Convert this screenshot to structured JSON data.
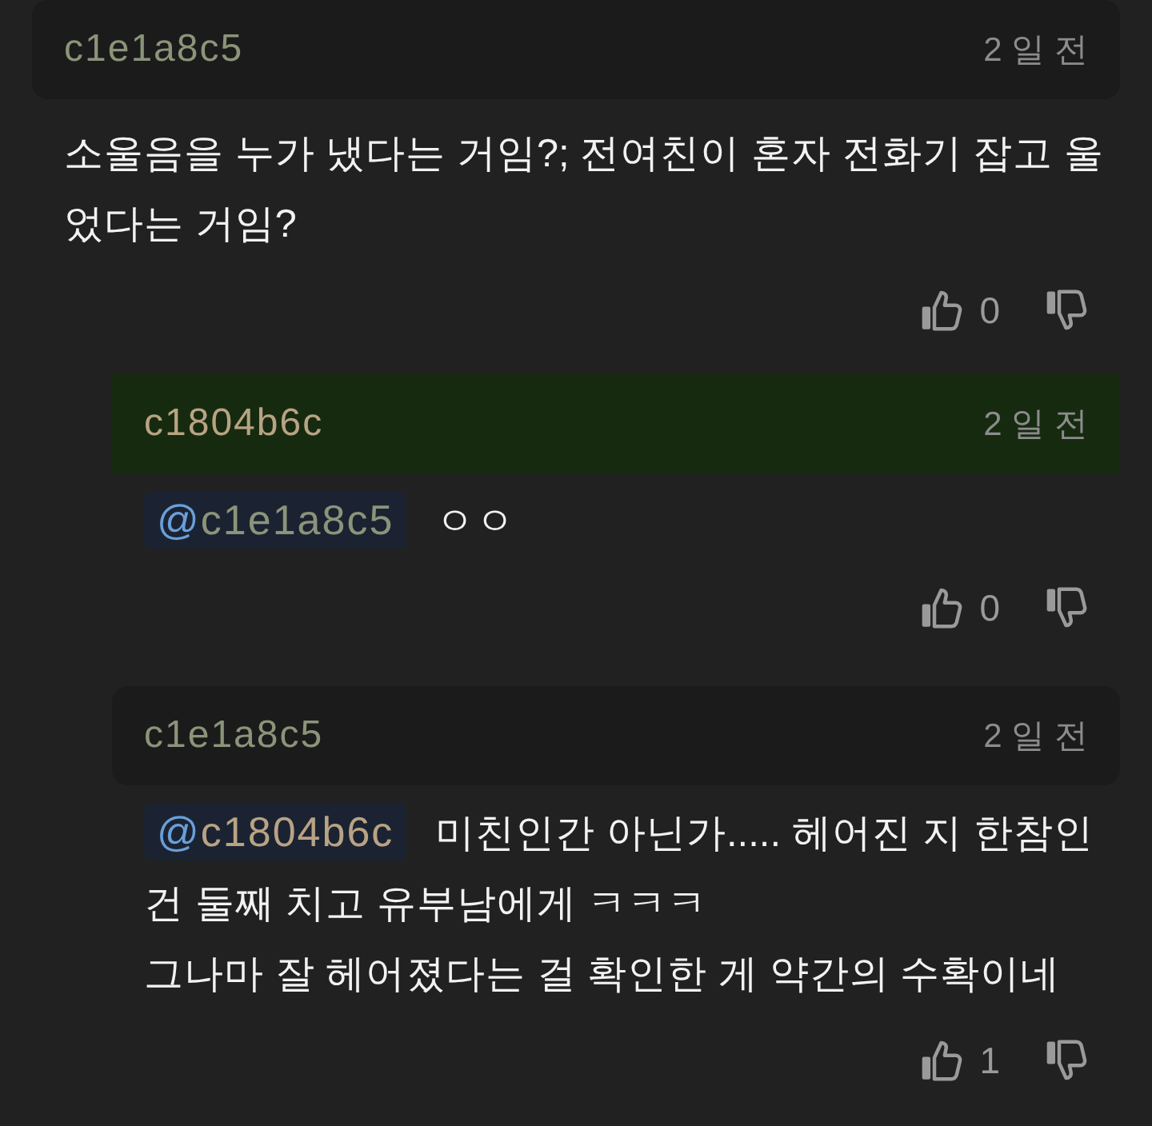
{
  "comments": [
    {
      "author": "c1e1a8c5",
      "color": "#8b9479",
      "time": "2 일 전",
      "highlighted": false,
      "text": "소울음을 누가 냈다는 거임?; 전여친이 혼자 전화기 잡고 울었다는 거임?",
      "likes": "0",
      "replies": [
        {
          "author": "c1804b6c",
          "color": "#b8a383",
          "time": "2 일 전",
          "highlighted": true,
          "mention": {
            "at": "@",
            "name": "c1e1a8c5",
            "color": "#8b9479"
          },
          "text": "ㅇㅇ",
          "likes": "0"
        },
        {
          "author": "c1e1a8c5",
          "color": "#8b9479",
          "time": "2 일 전",
          "highlighted": false,
          "mention": {
            "at": "@",
            "name": "c1804b6c",
            "color": "#b8a383"
          },
          "text": "미친인간 아닌가..... 헤어진 지 한참인 건 둘째 치고 유부남에게 ㅋㅋㅋ\n그나마 잘 헤어졌다는 걸 확인한 게 약간의 수확이네",
          "likes": "1"
        }
      ]
    }
  ]
}
